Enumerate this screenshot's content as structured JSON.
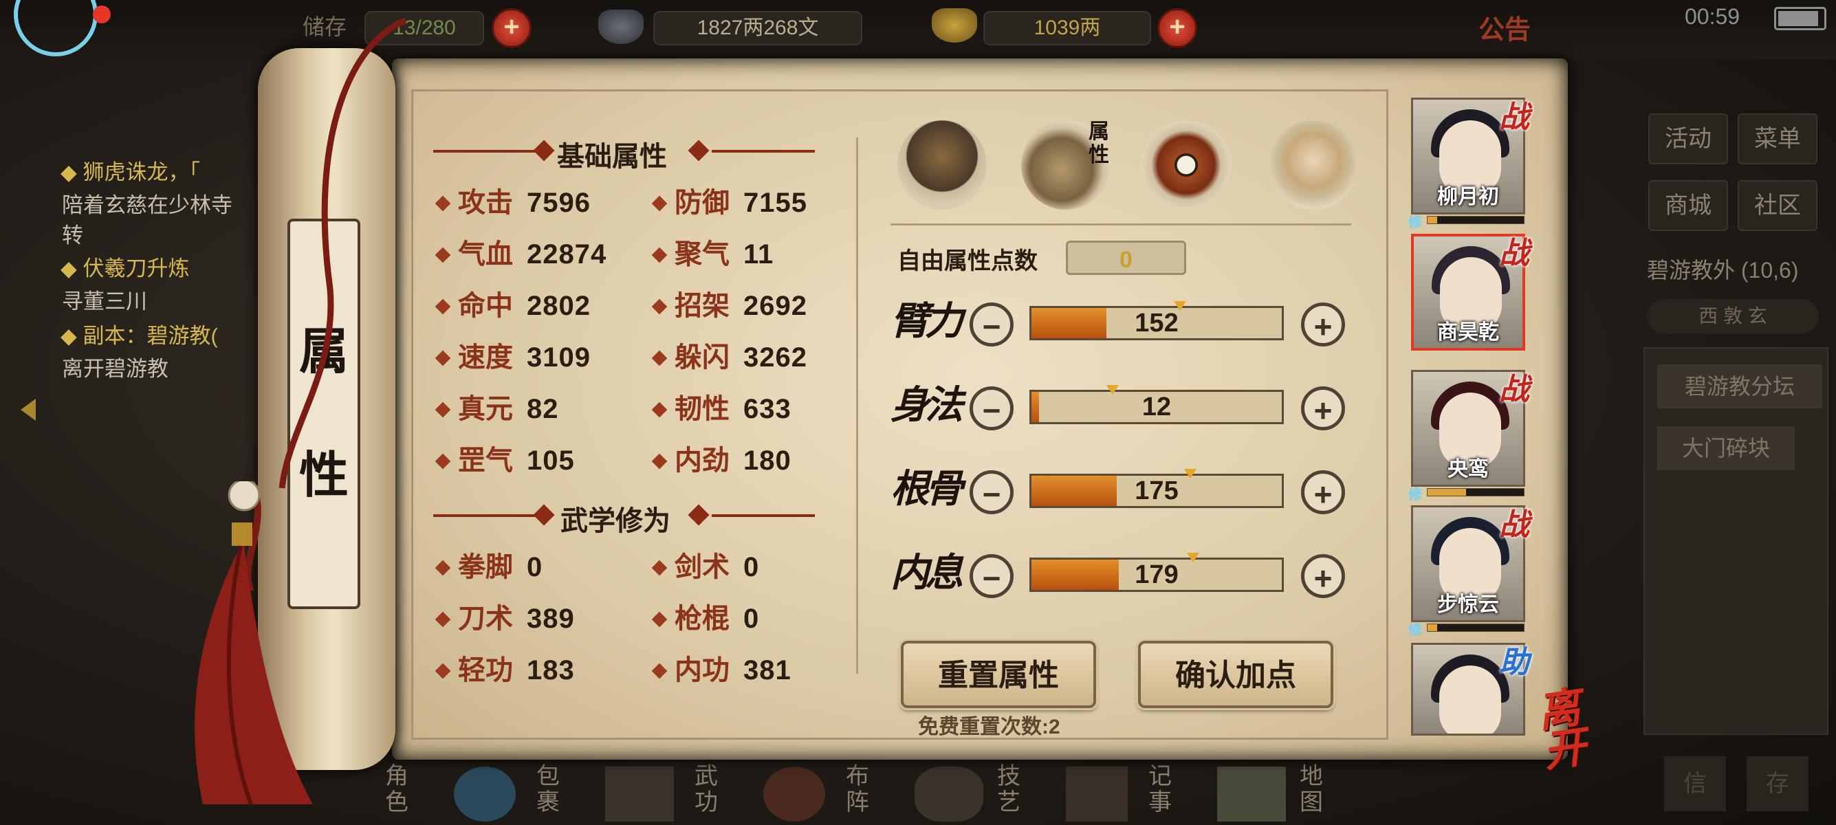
{
  "status": {
    "clock": "00:59"
  },
  "topbar": {
    "bag_label": "储存",
    "bag_count": "13/280",
    "silver": "1827两268文",
    "gold": "1039两",
    "notice": "公告"
  },
  "quests": [
    {
      "title": "◆ 狮虎诛龙，「",
      "desc": "陪着玄慈在少林寺",
      "desc2": "转"
    },
    {
      "title": "◆ 伏羲刀升炼",
      "desc": "寻董三川"
    },
    {
      "title": "◆ 副本：碧游教(",
      "desc": "离开碧游教"
    }
  ],
  "right_menu": {
    "activity": "活动",
    "menu": "菜单",
    "shop": "商城",
    "community": "社区",
    "location": "碧游教外 (10,6)",
    "map_tabs": "西 敦 玄",
    "places": [
      "碧游教分坛",
      "大门碎块"
    ],
    "bottom_left": "信",
    "bottom_right": "存"
  },
  "scroll_title": [
    "属",
    "性"
  ],
  "sections": {
    "basic": "基础属性",
    "martial": "武学修为"
  },
  "basic_stats": [
    {
      "name": "攻击",
      "value": "7596"
    },
    {
      "name": "防御",
      "value": "7155"
    },
    {
      "name": "气血",
      "value": "22874"
    },
    {
      "name": "聚气",
      "value": "11"
    },
    {
      "name": "命中",
      "value": "2802"
    },
    {
      "name": "招架",
      "value": "2692"
    },
    {
      "name": "速度",
      "value": "3109"
    },
    {
      "name": "躲闪",
      "value": "3262"
    },
    {
      "name": "真元",
      "value": "82"
    },
    {
      "name": "韧性",
      "value": "633"
    },
    {
      "name": "罡气",
      "value": "105"
    },
    {
      "name": "内劲",
      "value": "180"
    }
  ],
  "martial_stats": [
    {
      "name": "拳脚",
      "value": "0"
    },
    {
      "name": "剑术",
      "value": "0"
    },
    {
      "name": "刀术",
      "value": "389"
    },
    {
      "name": "枪棍",
      "value": "0"
    },
    {
      "name": "轻功",
      "value": "183"
    },
    {
      "name": "内功",
      "value": "381"
    }
  ],
  "tab_icons": [
    {
      "name": "hero-tab-icon"
    },
    {
      "name": "attribute-tab-icon",
      "label": "属性"
    },
    {
      "name": "bagua-tab-icon"
    },
    {
      "name": "meridian-tab-icon"
    }
  ],
  "free_points": {
    "label": "自由属性点数",
    "value": "0"
  },
  "attributes": [
    {
      "label": "臂力",
      "value": "152",
      "fill": 0.3
    },
    {
      "label": "身法",
      "value": "12",
      "fill": 0.03
    },
    {
      "label": "根骨",
      "value": "175",
      "fill": 0.34
    },
    {
      "label": "内息",
      "value": "179",
      "fill": 0.35
    }
  ],
  "buttons": {
    "reset": "重置属性",
    "confirm": "确认加点",
    "free_reset": "免费重置次数:2",
    "leave": "离开"
  },
  "party": [
    {
      "name": "柳月初",
      "badge": "战",
      "xiu": "修"
    },
    {
      "name": "商昊乾",
      "badge": "战",
      "xiu": ""
    },
    {
      "name": "央鸾",
      "badge": "战",
      "xiu": "修"
    },
    {
      "name": "步惊云",
      "badge": "战",
      "xiu": "修"
    },
    {
      "name": "",
      "badge": "助",
      "xiu": ""
    }
  ],
  "bottom_nav": [
    "角色",
    "包裹",
    "武功",
    "布阵",
    "技艺",
    "记事",
    "地图"
  ],
  "colors": {
    "accent_red": "#8a2b14",
    "bar_orange": "#d4741c",
    "gold_text": "#d7b84e"
  }
}
